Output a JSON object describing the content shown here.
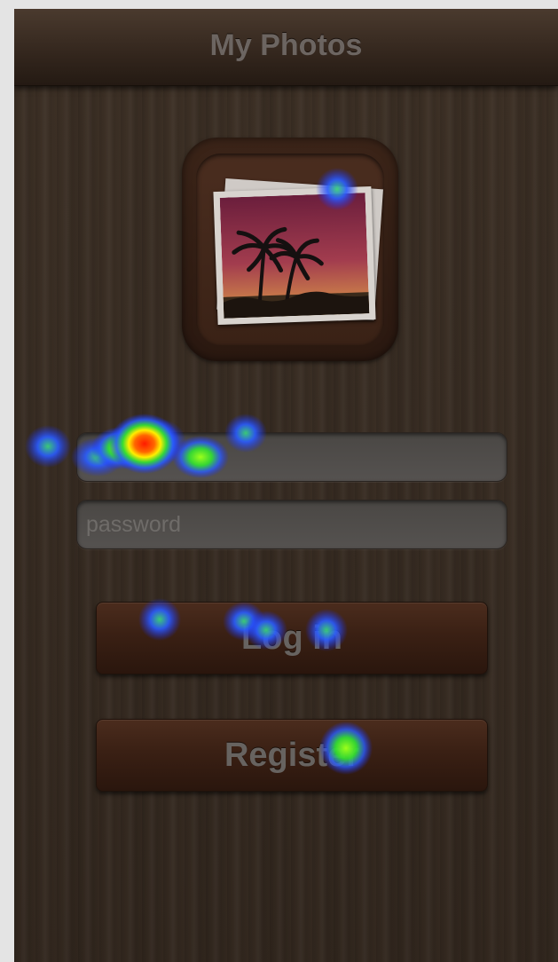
{
  "nav": {
    "title": "My Photos"
  },
  "login_form": {
    "username": {
      "value": "",
      "placeholder": ""
    },
    "password": {
      "value": "",
      "placeholder": "password"
    }
  },
  "buttons": {
    "login_label": "Log in",
    "register_label": "Register"
  },
  "app_icon": {
    "icon": "photos-icon"
  },
  "heatmap": {
    "colors": {
      "low": "#2a5cff",
      "mid": "#33dd33",
      "high": "#ffee00",
      "peak": "#ff1a00"
    }
  }
}
